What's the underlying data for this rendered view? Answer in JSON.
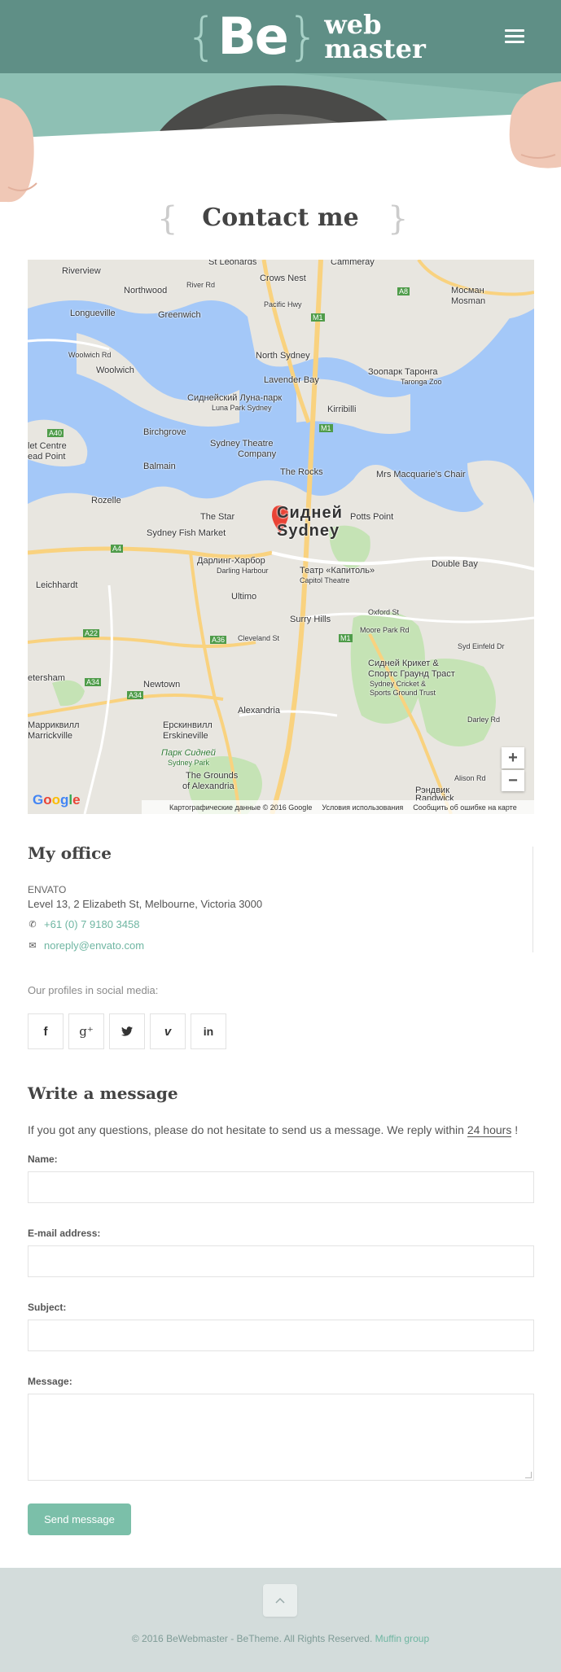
{
  "header": {
    "logo_be": "Be",
    "logo_web": "web",
    "logo_master": "master",
    "menu_icon": "hamburger-menu-icon"
  },
  "page": {
    "title": "Contact me"
  },
  "map": {
    "labels": {
      "st_leonards": "St Leonards",
      "cammeray": "Cammeray",
      "riverview": "Riverview",
      "crows_nest": "Crows Nest",
      "northwood": "Northwood",
      "river_rd": "River Rd",
      "pacific_hwy": "Pacific Hwy",
      "a8": "A8",
      "mosman_ru": "Мосман",
      "mosman": "Mosman",
      "longueville": "Longueville",
      "greenwich": "Greenwich",
      "m1_a": "M1",
      "woolwich_rd": "Woolwich Rd",
      "woolwich": "Woolwich",
      "north_sydney": "North Sydney",
      "zoo_ru": "Зоопарк Таронга",
      "zoo": "Taronga Zoo",
      "lavender_bay": "Lavender Bay",
      "luna_park_ru": "Сиднейский Луна-парк",
      "luna_park": "Luna Park Sydney",
      "kirribilli": "Kirribilli",
      "birchgrove": "Birchgrove",
      "m1_b": "M1",
      "a40": "A40",
      "let_centre": "let Centre",
      "ead_point": "ead Point",
      "balmain": "Balmain",
      "theatre": "Sydney Theatre",
      "company": "Company",
      "the_rocks": "The Rocks",
      "mrs_macquarie": "Mrs Macquarie's Chair",
      "rozelle": "Rozelle",
      "the_star": "The Star",
      "sydney_ru": "Сидней",
      "sydney": "Sydney",
      "potts_point": "Potts Point",
      "fish_market": "Sydney Fish Market",
      "a4": "A4",
      "darling_ru": "Дарлинг-Харбор",
      "darling": "Darling Harbour",
      "capitol_ru": "Театр «Капитоль»",
      "capitol": "Capitol Theatre",
      "double_bay": "Double Bay",
      "leichhardt": "Leichhardt",
      "ultimo": "Ultimo",
      "surry_hills": "Surry Hills",
      "oxford_st": "Oxford St",
      "a22": "A22",
      "a36": "A36",
      "cleveland_st": "Cleveland St",
      "m1_c": "M1",
      "moore_park_rd": "Moore Park Rd",
      "syd_einfeld": "Syd Einfeld Dr",
      "cricket_ru_1": "Сидней Крикет &",
      "cricket_ru_2": "Спортс Граунд Траст",
      "cricket_1": "Sydney Cricket &",
      "cricket_2": "Sports Ground Trust",
      "petersham": "etersham",
      "a34_a": "A34",
      "newtown": "Newtown",
      "a34_b": "A34",
      "marrickville_ru": "Марриквилл",
      "marrickville": "Marrickville",
      "alexandria": "Alexandria",
      "erskineville_ru": "Ерскинвилл",
      "erskineville": "Erskineville",
      "park_ru": "Парк Сидней",
      "park": "Sydney Park",
      "grounds_1": "The Grounds",
      "grounds_2": "of Alexandria",
      "randwick_ru": "Рэндвик",
      "randwick": "Randwick",
      "darley_rd": "Darley Rd",
      "alison_rd": "Alison Rd"
    },
    "zoom_in": "+",
    "zoom_out": "−",
    "google": "Google",
    "footer_data": "Картографические данные © 2016 Google",
    "footer_terms": "Условия использования",
    "footer_report": "Сообщить об ошибке на карте",
    "colors": {
      "water": "#a4c8f8",
      "land": "#e8e6e0",
      "park": "#c5e3b5",
      "road": "#ffffff",
      "highway": "#f9d27f",
      "marker": "#e94335"
    }
  },
  "office": {
    "title": "My office",
    "company": "ENVATO",
    "address": "Level 13, 2 Elizabeth St, Melbourne, Victoria 3000",
    "phone_icon": "phone-icon",
    "phone": "+61 (0) 7 9180 3458",
    "email_icon": "envelope-icon",
    "email": "noreply@envato.com"
  },
  "social": {
    "label": "Our profiles in social media:",
    "items": [
      {
        "icon": "facebook-icon",
        "glyph": "f"
      },
      {
        "icon": "google-plus-icon",
        "glyph": "g⁺"
      },
      {
        "icon": "twitter-icon",
        "glyph": "🐦"
      },
      {
        "icon": "vimeo-icon",
        "glyph": "v"
      },
      {
        "icon": "linkedin-icon",
        "glyph": "in"
      }
    ]
  },
  "form": {
    "title": "Write a message",
    "intro_before": "If you got any questions, please do not hesitate to send us a message. We reply within ",
    "intro_highlight": "24 hours",
    "intro_after": " !",
    "name_label": "Name:",
    "email_label": "E-mail address:",
    "subject_label": "Subject:",
    "message_label": "Message:",
    "submit": "Send message",
    "accent": "#7bbfa9"
  },
  "footer": {
    "to_top_icon": "chevron-up-icon",
    "copyright": "© 2016 BeWebmaster - BeTheme. All Rights Reserved. ",
    "link": "Muffin group",
    "background": "#d3dcdb"
  }
}
